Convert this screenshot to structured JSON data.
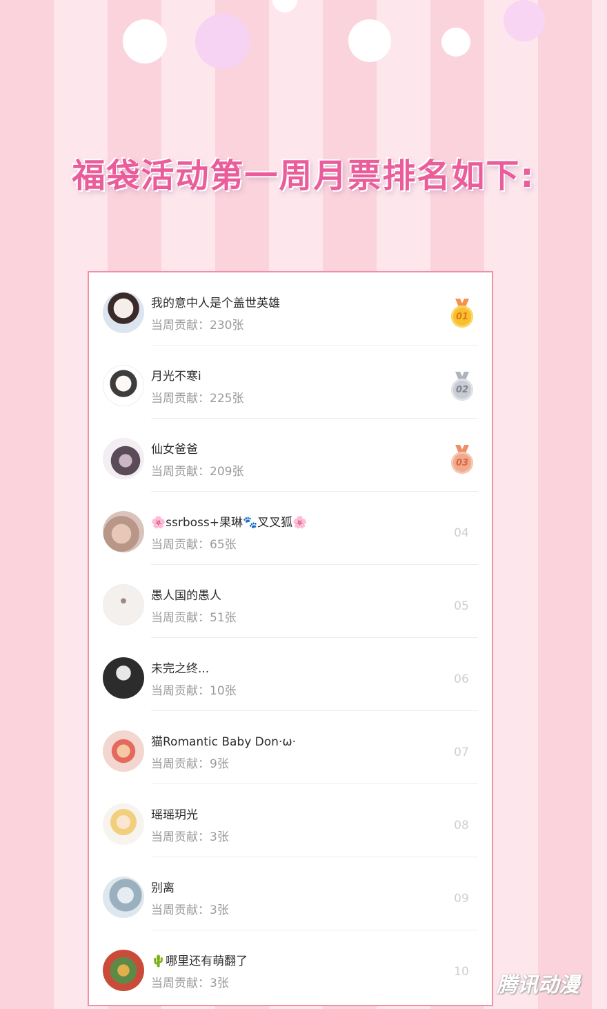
{
  "title": "福袋活动第一周月票排名如下:",
  "watermark": "腾讯动漫",
  "colors": {
    "title": "#ea5c9a",
    "border": "#f08fa6",
    "gold": "#f7c02e",
    "silver": "#c9ccd3",
    "bronze": "#f0a98c"
  },
  "rows": [
    {
      "rank": "01",
      "medal": "gold",
      "name": "我的意中人是个盖世英雄",
      "contrib": "当周贡献：230张",
      "avatar": "anime-girl-avatar"
    },
    {
      "rank": "02",
      "medal": "silver",
      "name": "月光不寒i",
      "contrib": "当周贡献：225张",
      "avatar": "anime-girl-avatar"
    },
    {
      "rank": "03",
      "medal": "bronze",
      "name": "仙女爸爸",
      "contrib": "当周贡献：209张",
      "avatar": "photo-avatar"
    },
    {
      "rank": "04",
      "medal": "",
      "name": "🌸ssrboss+果琳🐾叉叉狐🌸",
      "contrib": "当周贡献：65张",
      "avatar": "hands-photo-avatar"
    },
    {
      "rank": "05",
      "medal": "",
      "name": "愚人国的愚人",
      "contrib": "当周贡献：51张",
      "avatar": "sketch-avatar"
    },
    {
      "rank": "06",
      "medal": "",
      "name": "未完之终...",
      "contrib": "当周贡献：10张",
      "avatar": "hat-photo-avatar"
    },
    {
      "rank": "07",
      "medal": "",
      "name": "猫Romantic Baby Don·ω·",
      "contrib": "当周贡献：9张",
      "avatar": "cartoon-avatar"
    },
    {
      "rank": "08",
      "medal": "",
      "name": "瑶瑶玥光",
      "contrib": "当周贡献：3张",
      "avatar": "anime-boy-avatar"
    },
    {
      "rank": "09",
      "medal": "",
      "name": "别离",
      "contrib": "当周贡献：3张",
      "avatar": "blurred-photo-avatar"
    },
    {
      "rank": "10",
      "medal": "",
      "name": "🌵哪里还有萌翻了",
      "contrib": "当周贡献：3张",
      "avatar": "colorful-cartoon-avatar"
    }
  ]
}
